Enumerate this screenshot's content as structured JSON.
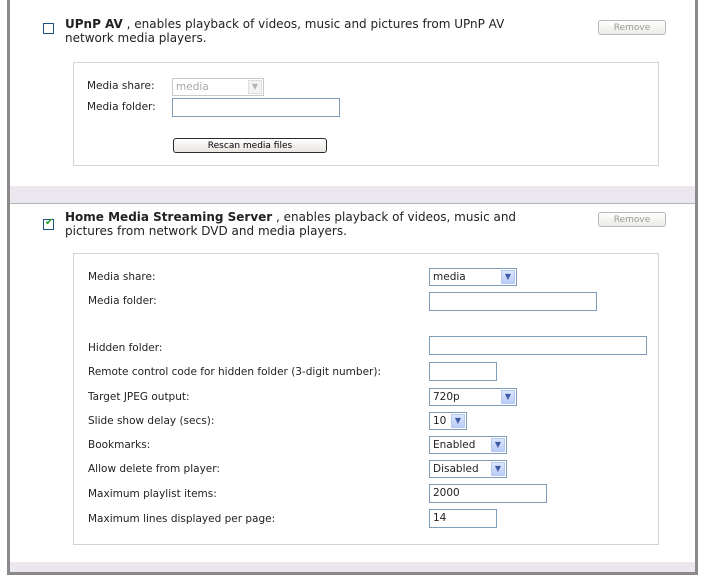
{
  "upnp": {
    "checked": false,
    "name": "UPnP AV",
    "description_line1": " , enables playback of videos, music and pictures from UPnP AV",
    "description_line2": "network media players.",
    "remove_label": "Remove",
    "media_share_label": "Media share:",
    "media_share_value": "media",
    "media_folder_label": "Media folder:",
    "media_folder_value": "",
    "rescan_label": "Rescan media files"
  },
  "hmss": {
    "checked": true,
    "name": "Home Media Streaming Server",
    "description_line1": " , enables playback of videos, music and",
    "description_line2": "pictures from network DVD and media players.",
    "remove_label": "Remove",
    "fields": {
      "media_share": {
        "label": "Media share:",
        "value": "media"
      },
      "media_folder": {
        "label": "Media folder:",
        "value": ""
      },
      "hidden_folder": {
        "label": "Hidden folder:",
        "value": ""
      },
      "remote_code": {
        "label": "Remote control code for hidden folder (3-digit number):",
        "value": ""
      },
      "jpeg_output": {
        "label": "Target JPEG output:",
        "value": "720p"
      },
      "slide_delay": {
        "label": "Slide show delay (secs):",
        "value": "10"
      },
      "bookmarks": {
        "label": "Bookmarks:",
        "value": "Enabled"
      },
      "allow_delete": {
        "label": "Allow delete from player:",
        "value": "Disabled"
      },
      "max_playlist": {
        "label": "Maximum playlist items:",
        "value": "2000"
      },
      "max_lines": {
        "label": "Maximum lines displayed per page:",
        "value": "14"
      }
    }
  }
}
